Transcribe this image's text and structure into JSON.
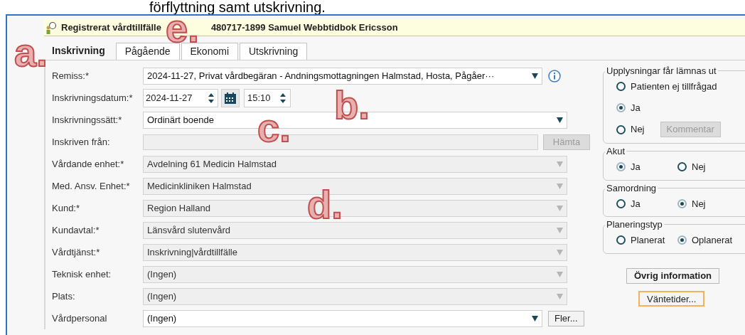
{
  "caption": "förflyttning samt utskrivning.",
  "header": {
    "title": "Registrerat vårdtillfälle",
    "patient": "480717-1899 Samuel Webbtidbok Ericsson"
  },
  "tabs": [
    {
      "label": "Inskrivning",
      "selected": true
    },
    {
      "label": "Pågående",
      "selected": false
    },
    {
      "label": "Ekonomi",
      "selected": false
    },
    {
      "label": "Utskrivning",
      "selected": false
    }
  ],
  "fields": [
    {
      "kind": "select",
      "label": "Remiss:*",
      "value": "2024-11-27, Privat vårdbegäran  - Andningsmottagningen Halmstad, Hosta, Pågåer···",
      "disabled": false,
      "info": true
    },
    {
      "kind": "datetime",
      "label": "Inskrivningsdatum:*",
      "value": "2024-11-27",
      "time": "15:10",
      "disabled": false
    },
    {
      "kind": "select",
      "label": "Inskrivningssätt:*",
      "value": "Ordinärt boende",
      "disabled": false
    },
    {
      "kind": "text",
      "label": "Inskriven från:",
      "disabled": true,
      "button": {
        "label": "Hämta",
        "disabled": true
      }
    },
    {
      "kind": "select",
      "label": "Vårdande enhet:*",
      "value": "Avdelning 61 Medicin Halmstad",
      "disabled": true
    },
    {
      "kind": "select",
      "label": "Med. Ansv. Enhet:*",
      "value": "Medicinkliniken Halmstad",
      "disabled": true
    },
    {
      "kind": "select",
      "label": "Kund:*",
      "value": "Region Halland",
      "disabled": true
    },
    {
      "kind": "select",
      "label": "Kundavtal:*",
      "value": "Länsvård slutenvård",
      "disabled": true
    },
    {
      "kind": "select",
      "label": "Vårdtjänst:*",
      "value": "Inskrivning|vårdtillfälle",
      "disabled": true
    },
    {
      "kind": "select",
      "label": "Teknisk enhet:",
      "value": "(Ingen)",
      "disabled": true
    },
    {
      "kind": "select",
      "label": "Plats:",
      "value": "(Ingen)",
      "disabled": true
    },
    {
      "kind": "select",
      "label": "Vårdpersonal",
      "value": "(Ingen)",
      "disabled": false,
      "button": {
        "label": "Fler...",
        "disabled": false
      }
    }
  ],
  "groups": [
    {
      "title": "Upplysningar får lämnas ut",
      "options": [
        {
          "label": "Patienten ej tillfrågad",
          "selected": false
        },
        {
          "label": "Ja",
          "selected": true
        },
        {
          "label": "Nej",
          "selected": false
        }
      ],
      "button": {
        "label": "Kommentar",
        "disabled": true
      }
    },
    {
      "title": "Akut",
      "options": [
        {
          "label": "Ja",
          "selected": true
        },
        {
          "label": "Nej",
          "selected": false
        }
      ]
    },
    {
      "title": "Samordning",
      "options": [
        {
          "label": "Ja",
          "selected": false
        },
        {
          "label": "Nej",
          "selected": true
        }
      ]
    },
    {
      "title": "Planeringstyp",
      "options": [
        {
          "label": "Planerat",
          "selected": false
        },
        {
          "label": "Oplanerat",
          "selected": true
        }
      ]
    }
  ],
  "buttons": [
    {
      "label": "Övrig information",
      "focused": false
    },
    {
      "label": "Väntetider...",
      "focused": true
    }
  ],
  "annotations": [
    "a.",
    "b.",
    "c.",
    "d.",
    "e."
  ]
}
